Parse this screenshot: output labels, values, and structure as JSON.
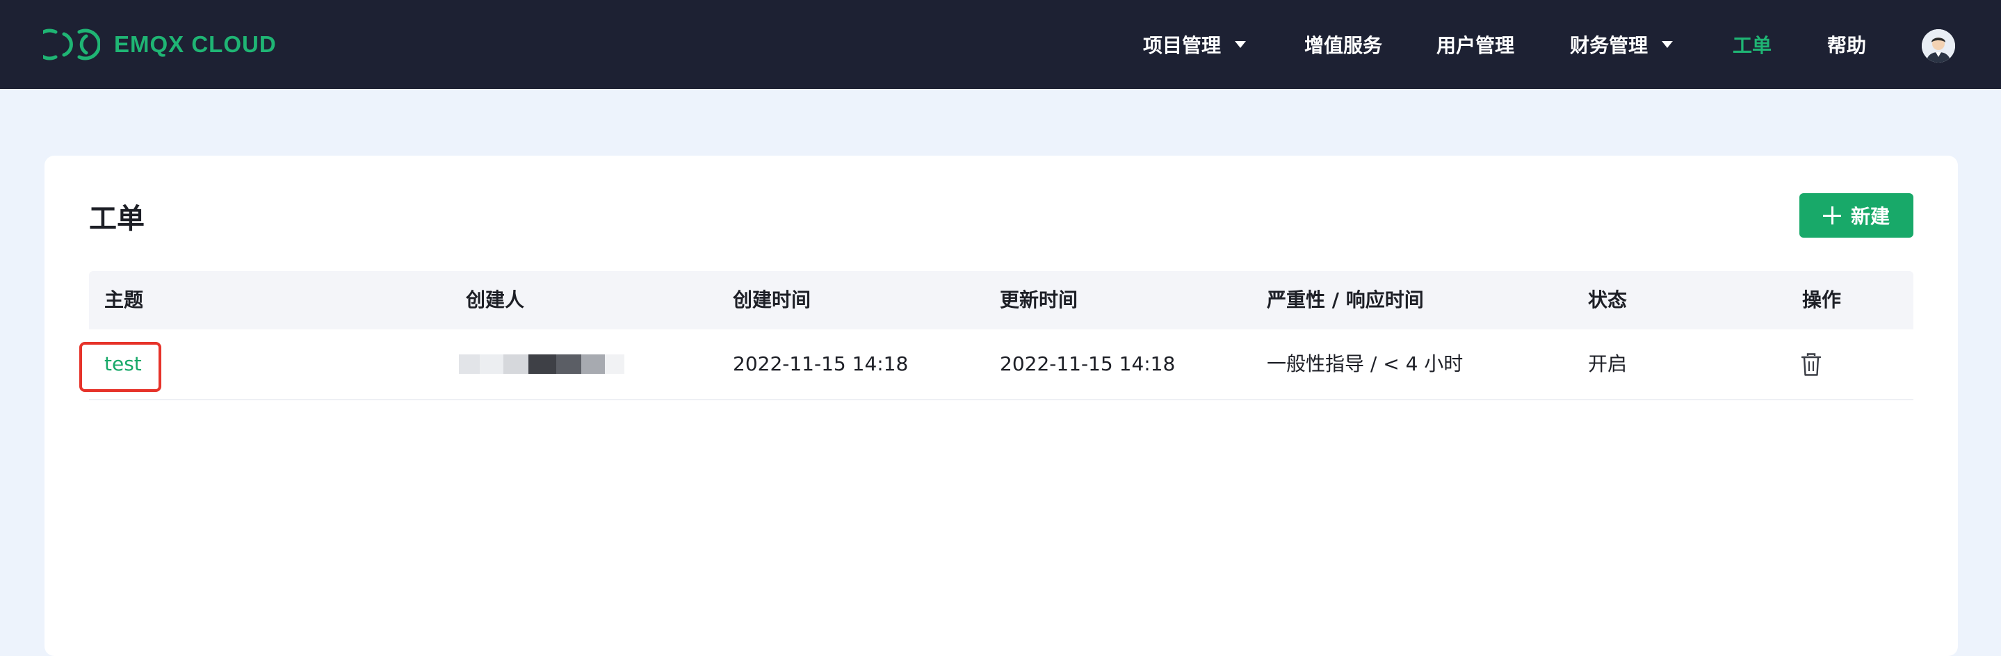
{
  "header": {
    "logo_text": "EMQX CLOUD",
    "nav": [
      {
        "label": "项目管理"
      },
      {
        "label": "增值服务"
      },
      {
        "label": "用户管理"
      },
      {
        "label": "财务管理"
      },
      {
        "label": "工单"
      },
      {
        "label": "帮助"
      }
    ],
    "active_item": "工单"
  },
  "page": {
    "title": "工单",
    "new_button_label": "新建"
  },
  "table": {
    "columns": [
      "主题",
      "创建人",
      "创建时间",
      "更新时间",
      "严重性 / 响应时间",
      "状态",
      "操作"
    ],
    "rows": [
      {
        "subject": "test",
        "creator": "",
        "created_at": "2022-11-15 14:18",
        "updated_at": "2022-11-15 14:18",
        "severity": "一般性指导 / < 4 小时",
        "status": "开启",
        "action_icon": "trash-icon"
      }
    ]
  },
  "colors": {
    "header_bg": "#1d2133",
    "brand_green": "#18a969",
    "page_bg": "#edf3fc",
    "highlight_red": "#e6332a"
  }
}
